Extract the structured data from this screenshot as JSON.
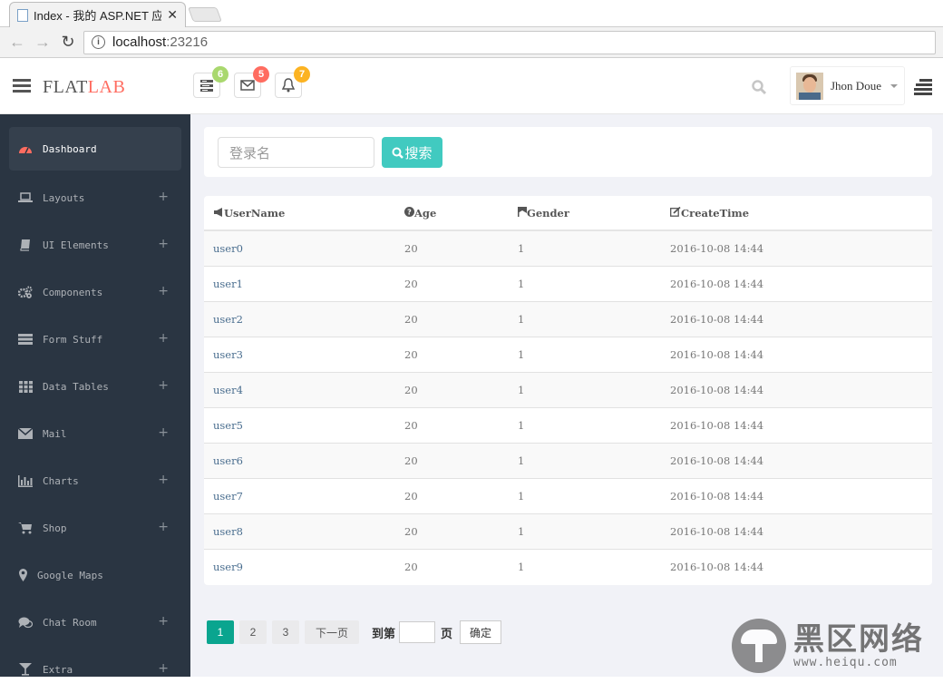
{
  "browser": {
    "tab_title": "Index - 我的 ASP.NET 应",
    "url_host": "localhost",
    "url_port": ":23216"
  },
  "header": {
    "logo_part1": "FLAT",
    "logo_part2": "LAB",
    "notifications": [
      {
        "icon": "tasks-icon",
        "count": "6",
        "color": "#a9d86e"
      },
      {
        "icon": "envelope-icon",
        "count": "5",
        "color": "#ff6c60"
      },
      {
        "icon": "bell-icon",
        "count": "7",
        "color": "#fcb322"
      }
    ],
    "user_name": "Jhon Doue"
  },
  "sidebar": {
    "items": [
      {
        "label": "Dashboard",
        "icon": "dashboard-icon",
        "active": true,
        "expandable": false
      },
      {
        "label": "Layouts",
        "icon": "laptop-icon",
        "expandable": true
      },
      {
        "label": "UI Elements",
        "icon": "book-icon",
        "expandable": true
      },
      {
        "label": "Components",
        "icon": "cogs-icon",
        "expandable": true
      },
      {
        "label": "Form Stuff",
        "icon": "tasks-icon",
        "expandable": true
      },
      {
        "label": "Data Tables",
        "icon": "th-icon",
        "expandable": true
      },
      {
        "label": "Mail",
        "icon": "envelope-icon",
        "expandable": true
      },
      {
        "label": "Charts",
        "icon": "bar-chart-icon",
        "expandable": true
      },
      {
        "label": "Shop",
        "icon": "shopping-cart-icon",
        "expandable": true
      },
      {
        "label": "Google Maps",
        "icon": "map-marker-icon",
        "expandable": false
      },
      {
        "label": "Chat Room",
        "icon": "comments-icon",
        "expandable": true
      },
      {
        "label": "Extra",
        "icon": "glass-icon",
        "expandable": true
      }
    ],
    "plus": "+"
  },
  "search": {
    "placeholder": "登录名",
    "button_label": "搜索"
  },
  "table": {
    "columns": [
      {
        "label": "UserName",
        "icon": "bullhorn-icon"
      },
      {
        "label": "Age",
        "icon": "question-circle-icon"
      },
      {
        "label": "Gender",
        "icon": "bookmark-icon"
      },
      {
        "label": "CreateTime",
        "icon": "edit-icon"
      }
    ],
    "rows": [
      [
        "user0",
        "20",
        "1",
        "2016-10-08 14:44"
      ],
      [
        "user1",
        "20",
        "1",
        "2016-10-08 14:44"
      ],
      [
        "user2",
        "20",
        "1",
        "2016-10-08 14:44"
      ],
      [
        "user3",
        "20",
        "1",
        "2016-10-08 14:44"
      ],
      [
        "user4",
        "20",
        "1",
        "2016-10-08 14:44"
      ],
      [
        "user5",
        "20",
        "1",
        "2016-10-08 14:44"
      ],
      [
        "user6",
        "20",
        "1",
        "2016-10-08 14:44"
      ],
      [
        "user7",
        "20",
        "1",
        "2016-10-08 14:44"
      ],
      [
        "user8",
        "20",
        "1",
        "2016-10-08 14:44"
      ],
      [
        "user9",
        "20",
        "1",
        "2016-10-08 14:44"
      ]
    ]
  },
  "pagination": {
    "pages": [
      "1",
      "2",
      "3"
    ],
    "current": "1",
    "next_label": "下一页",
    "goto_prefix": "到第",
    "goto_suffix": "页",
    "confirm_label": "确定"
  },
  "watermark": {
    "text": "黑区网络",
    "url": "www.heiqu.com"
  }
}
